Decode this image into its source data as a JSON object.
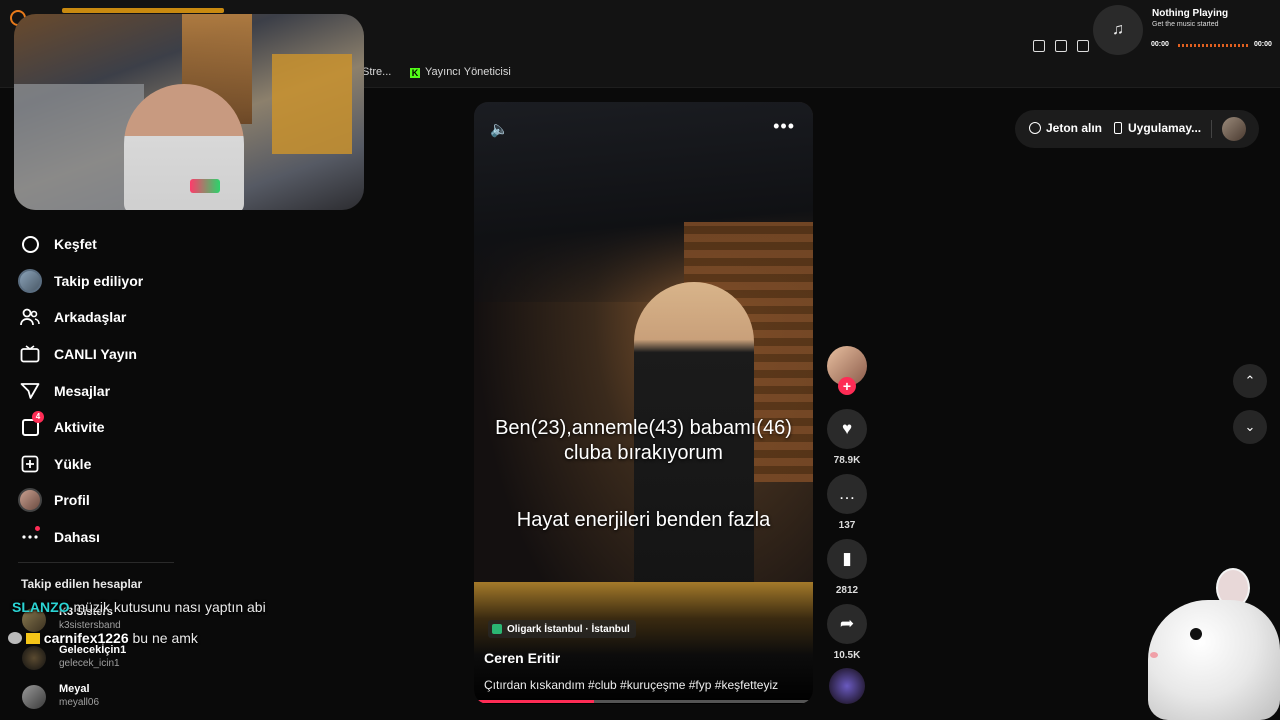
{
  "browser": {
    "bookmark_stream": "Stre...",
    "bookmark_kick": "Yayıncı Yöneticisi",
    "kick_icon_letter": "K"
  },
  "music": {
    "icon": "♫",
    "title": "Nothing Playing",
    "subtitle": "Get the music started",
    "time_start": "00:00",
    "time_end": "00:00"
  },
  "sidebar": {
    "items": [
      {
        "label": "Keşfet",
        "icon": "compass-icon"
      },
      {
        "label": "Takip ediliyor",
        "icon": "avatar"
      },
      {
        "label": "Arkadaşlar",
        "icon": "friends-icon"
      },
      {
        "label": "CANLI Yayın",
        "icon": "live-tv-icon"
      },
      {
        "label": "Mesajlar",
        "icon": "send-icon"
      },
      {
        "label": "Aktivite",
        "icon": "activity-icon",
        "badge": "4"
      },
      {
        "label": "Yükle",
        "icon": "upload-icon"
      },
      {
        "label": "Profil",
        "icon": "avatar"
      },
      {
        "label": "Dahası",
        "icon": "more-icon"
      }
    ],
    "following_heading": "Takip edilen hesaplar",
    "accounts": [
      {
        "name": "K3 Sisters",
        "handle": "k3sistersband"
      },
      {
        "name": "Gelecekİçin1",
        "handle": "gelecek_icin1"
      },
      {
        "name": "Meyal",
        "handle": "meyall06"
      }
    ]
  },
  "chat": [
    {
      "user": "SLANZO",
      "message": "müzik kutusunu nası yaptın abi"
    },
    {
      "user": "carnifex1226",
      "message": "bu ne amk"
    }
  ],
  "video": {
    "caption_line1": "Ben(23),annemle(43) babamı(46)",
    "caption_line2": "cluba bırakıyorum",
    "caption_line3": "Hayat enerjileri benden fazla",
    "location": "Oligark İstanbul · İstanbul",
    "author": "Ceren Eritir",
    "description": "Çıtırdan kıskandım #club #kuruçeşme #fyp #keşfetteyiz",
    "progress": 0.35,
    "more_icon": "•••",
    "mute_icon": "🔈"
  },
  "actions": {
    "plus": "+",
    "like_icon": "♥",
    "comment_icon": "…",
    "save_icon": "▮",
    "share_icon": "➦",
    "likes": "78.9K",
    "comments": "137",
    "saves": "2812",
    "shares": "10.5K"
  },
  "header_right": {
    "coins_label": "Jeton alın",
    "app_label": "Uygulamay..."
  },
  "arrows": {
    "up": "⌃",
    "down": "⌄"
  },
  "colors": {
    "accent": "#fe2c55",
    "chat_user1": "#2bd4d4",
    "kick_green": "#53fc18"
  }
}
